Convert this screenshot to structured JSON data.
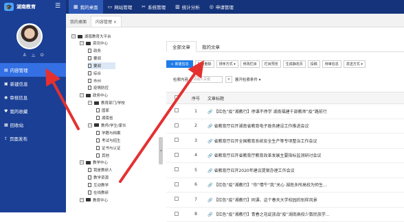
{
  "app": {
    "logo": "湖南教育"
  },
  "topnav": [
    {
      "icon": "▦",
      "label": "我的桌面",
      "active": true
    },
    {
      "icon": "▭",
      "label": "网站管理"
    },
    {
      "icon": "✂",
      "label": "系统管理"
    },
    {
      "icon": "▥",
      "label": "统计分析"
    },
    {
      "icon": "◎",
      "label": "申请管理"
    }
  ],
  "sidebar": {
    "user_icons": "♙ △ ⏻",
    "items": [
      {
        "icon": "▤",
        "label": "内容管理",
        "active": true
      },
      {
        "icon": "▣",
        "label": "新建信息"
      },
      {
        "icon": "◉",
        "label": "审核信息"
      },
      {
        "icon": "♥",
        "label": "我的收藏"
      },
      {
        "icon": "▦",
        "label": "回收站"
      },
      {
        "icon": "⇪",
        "label": "页面发布"
      }
    ]
  },
  "tabs": [
    {
      "label": "我的桌面"
    },
    {
      "label": "内容管理 ×",
      "active": true
    }
  ],
  "tree": {
    "root": "湖南教育大平台",
    "items": [
      {
        "label": "资讯中心",
        "level": 1,
        "type": "folder"
      },
      {
        "label": "政务",
        "level": 2,
        "type": "file"
      },
      {
        "label": "要闻",
        "level": 2,
        "type": "file"
      },
      {
        "label": "要闻",
        "level": 2,
        "type": "file",
        "selected": true
      },
      {
        "label": "综合",
        "level": 2,
        "type": "file"
      },
      {
        "label": "市州",
        "level": 2,
        "type": "file"
      },
      {
        "label": "疫情防控",
        "level": 2,
        "type": "file"
      },
      {
        "label": "政务中心",
        "level": 1,
        "type": "folder"
      },
      {
        "label": "教育部门/学校",
        "level": 2,
        "type": "folder"
      },
      {
        "label": "国家",
        "level": 3,
        "type": "file"
      },
      {
        "label": "湖南省",
        "level": 3,
        "type": "file"
      },
      {
        "label": "教师/学生/家长",
        "level": 2,
        "type": "folder"
      },
      {
        "label": "学籍与档案",
        "level": 3,
        "type": "file"
      },
      {
        "label": "考试与招生",
        "level": 3,
        "type": "file"
      },
      {
        "label": "证书与认证",
        "level": 3,
        "type": "file"
      },
      {
        "label": "其他",
        "level": 3,
        "type": "file"
      },
      {
        "label": "教学中心",
        "level": 1,
        "type": "folder"
      },
      {
        "label": "我是教研人",
        "level": 2,
        "type": "file"
      },
      {
        "label": "教学资源",
        "level": 2,
        "type": "file"
      },
      {
        "label": "互动教学",
        "level": 2,
        "type": "file"
      },
      {
        "label": "在线教研",
        "level": 2,
        "type": "file"
      },
      {
        "label": "教育中心",
        "level": 1,
        "type": "folder"
      }
    ]
  },
  "content": {
    "tabs": [
      {
        "label": "全部文章",
        "active": true
      },
      {
        "label": "我的文章"
      }
    ],
    "toolbar": [
      {
        "label": "＋ 新建信息",
        "primary": true
      },
      {
        "label": "批量删除"
      },
      {
        "label": "排序方式 ▾"
      },
      {
        "label": "修改栏目"
      },
      {
        "label": "栏目预览"
      },
      {
        "label": "生成静态页"
      },
      {
        "label": "投稿"
      },
      {
        "label": "待审信息"
      },
      {
        "label": "发送方式 ▾"
      }
    ],
    "search": {
      "label": "检索内容",
      "placeholder": "请输入关键",
      "expand": "展开检索条件 ▾"
    },
    "table": {
      "headers": [
        "序号",
        "文章标题"
      ],
      "rows": [
        {
          "n": "1",
          "title": "【红色“疫”湘教行】停课不停学 湖南福建千部教师“疫”路前行"
        },
        {
          "n": "2",
          "title": "省教育厅召开湖南省教育电子政务建设工作推进会议"
        },
        {
          "n": "3",
          "title": "省教育厅召开全国教育系统安全生产等专项整治工作会议"
        },
        {
          "n": "4",
          "title": "省教育厅召开省教育厅教育改革发展主要指标监测研讨会议"
        },
        {
          "n": "5",
          "title": "省教育厅召开2020年建议提案办理工作会议"
        },
        {
          "n": "6",
          "title": "【红色“疫”湘教行】“你”情牛“我”关心 湖南多所高校为师生…"
        },
        {
          "n": "7",
          "title": "【红色“疫”湘教行】同课、这个春天大学校园的别样风景"
        },
        {
          "n": "8",
          "title": "【红色“疫”湘教行】青春之花绽放战“疫”湖南高校少数民族学…"
        }
      ]
    }
  }
}
